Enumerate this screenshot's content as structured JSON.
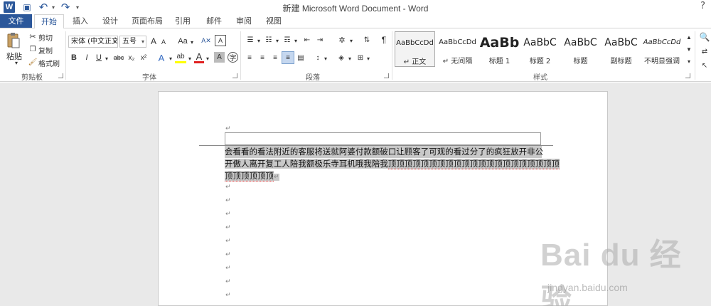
{
  "window": {
    "title": "新建 Microsoft Word Document - Word",
    "help": "?"
  },
  "quick_access": {
    "logo": "W",
    "icons": [
      "save-icon",
      "undo-icon",
      "redo-icon",
      "customize-icon"
    ],
    "undo_glyph": "↶",
    "redo_glyph": "↷",
    "save_glyph": "▣"
  },
  "tabs": [
    {
      "label": "文件"
    },
    {
      "label": "开始"
    },
    {
      "label": "插入"
    },
    {
      "label": "设计"
    },
    {
      "label": "页面布局"
    },
    {
      "label": "引用"
    },
    {
      "label": "邮件"
    },
    {
      "label": "审阅"
    },
    {
      "label": "视图"
    }
  ],
  "clipboard": {
    "paste": "粘贴",
    "cut": "剪切",
    "copy": "复制",
    "format_painter": "格式刷",
    "group": "剪贴板"
  },
  "font": {
    "name": "宋体 (中文正文)",
    "size": "五号",
    "grow": "A",
    "shrink": "A",
    "case": "Aa",
    "bold": "B",
    "italic": "I",
    "underline": "U",
    "strike": "abc",
    "subscript": "x₂",
    "superscript": "x²",
    "group": "字体"
  },
  "paragraph": {
    "group": "段落"
  },
  "styles": {
    "group": "样式",
    "items": [
      {
        "sample": "AaBbCcDd",
        "name": "正文",
        "selected": true
      },
      {
        "sample": "AaBbCcDd",
        "name": "无间隔",
        "selected": false
      },
      {
        "sample": "AaBb",
        "name": "标题 1",
        "selected": false
      },
      {
        "sample": "AaBbC",
        "name": "标题 2",
        "selected": false
      },
      {
        "sample": "AaBbC",
        "name": "标题",
        "selected": false
      },
      {
        "sample": "AaBbC",
        "name": "副标题",
        "selected": false
      },
      {
        "sample": "AaBbCcDd",
        "name": "不明显强调",
        "selected": false
      }
    ]
  },
  "document": {
    "paragraph_mark": "↵",
    "text_line1": "会看看的看法附近的客服将送就阿婆付款额破口让顾客了可观的看过分了的疯狂放开非公",
    "text_line2_plain": "开傲人离开复工人陪我额极乐寺耳机哦我陪我",
    "text_line2_rep": "顶顶顶顶顶顶顶顶顶顶顶顶顶顶顶顶顶顶顶顶顶",
    "text_line3": "顶顶顶顶顶顶"
  },
  "watermark": {
    "text": "Bai du 经验",
    "url": "jingyan.baidu.com"
  }
}
